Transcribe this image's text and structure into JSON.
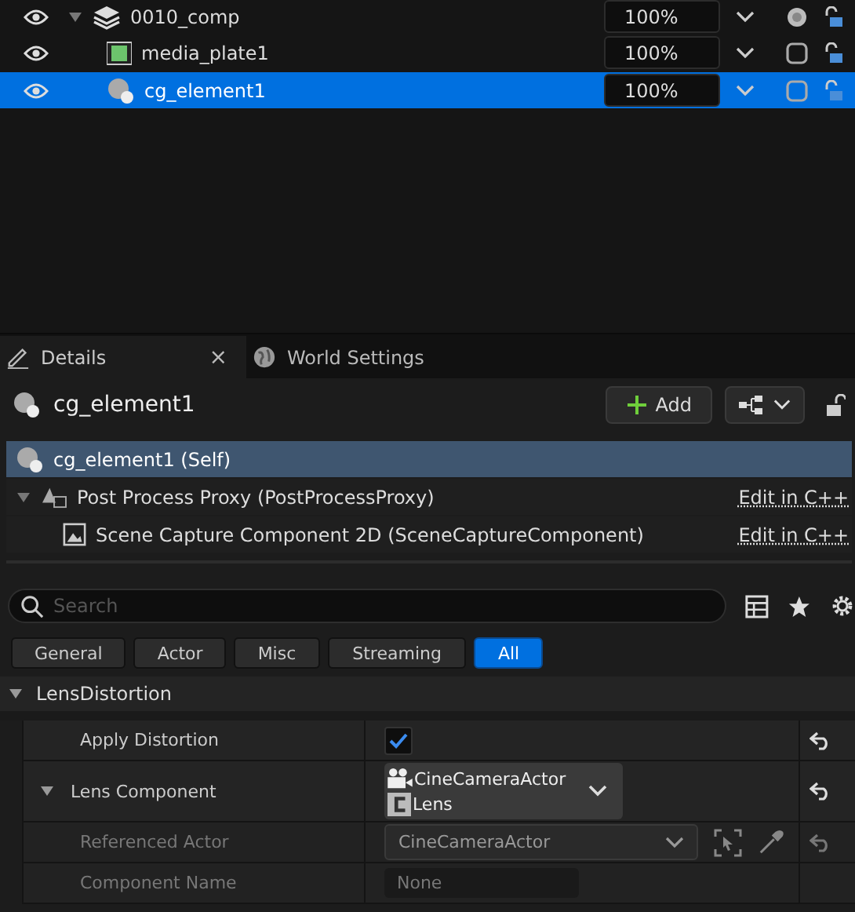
{
  "outliner": {
    "rows": [
      {
        "name": "0010_comp",
        "kind": "group",
        "expanded": true,
        "selected": false,
        "opacity": "100%",
        "children": [
          {
            "name": "media_plate1",
            "kind": "media",
            "selected": false,
            "opacity": "100%"
          },
          {
            "name": "cg_element1",
            "kind": "actor",
            "selected": true,
            "opacity": "100%"
          }
        ]
      }
    ]
  },
  "tabs": [
    {
      "label": "Details",
      "selected": true,
      "close": "×"
    },
    {
      "label": "World Settings",
      "selected": false
    }
  ],
  "header": {
    "title": "cg_element1",
    "add_label": "Add"
  },
  "components": [
    {
      "label": "cg_element1 (Self)",
      "kind": "actor",
      "selected": true
    },
    {
      "label": "Post Process Proxy (PostProcessProxy)",
      "kind": "proxy",
      "selected": false,
      "expanded": true,
      "link": "Edit in C++",
      "children": [
        {
          "label": "Scene Capture Component 2D (SceneCaptureComponent)",
          "kind": "capture",
          "selected": false,
          "link": "Edit in C++"
        }
      ]
    }
  ],
  "search": {
    "placeholder": "Search"
  },
  "filters": [
    {
      "label": "General",
      "selected": false
    },
    {
      "label": "Actor",
      "selected": false
    },
    {
      "label": "Misc",
      "selected": false
    },
    {
      "label": "Streaming",
      "selected": false
    },
    {
      "label": "All",
      "selected": true
    }
  ],
  "section": {
    "title": "LensDistortion",
    "expanded": true,
    "properties": [
      {
        "name": "Apply Distortion",
        "kind": "checkbox",
        "checked": true,
        "disabled": false
      },
      {
        "name": "Lens Component",
        "kind": "object",
        "expanded": true,
        "values": [
          "CineCameraActor",
          "Lens"
        ],
        "disabled": false,
        "children": [
          {
            "name": "Referenced Actor",
            "kind": "dropdown",
            "value": "CineCameraActor",
            "disabled": true
          },
          {
            "name": "Component Name",
            "kind": "text",
            "value": "None",
            "disabled": true
          }
        ]
      }
    ]
  }
}
